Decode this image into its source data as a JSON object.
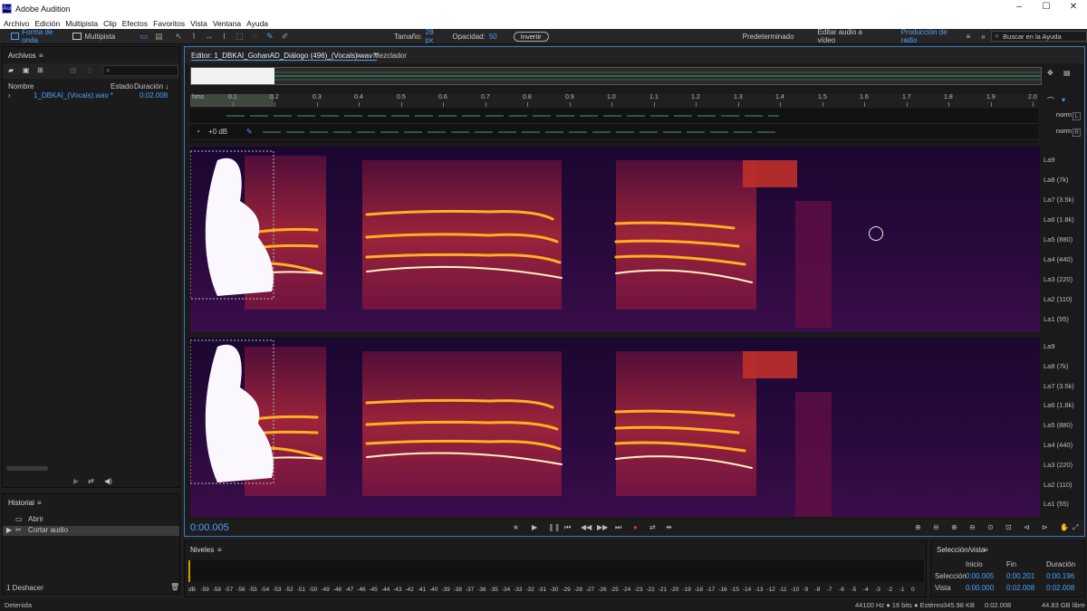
{
  "app": {
    "title": "Adobe Audition",
    "logo": "Au"
  },
  "window": {
    "minimize": "–",
    "maximize": "☐",
    "close": "✕"
  },
  "menu": [
    "Archivo",
    "Edición",
    "Multipista",
    "Clip",
    "Efectos",
    "Favoritos",
    "Vista",
    "Ventana",
    "Ayuda"
  ],
  "toolbar": {
    "waveform": "Forma de onda",
    "multitrack": "Multipista",
    "size_label": "Tamaño:",
    "size_value": "28 px",
    "opacity_label": "Opacidad:",
    "opacity_value": "50",
    "invert": "Invertir",
    "workspace_default": "Predeterminado",
    "workspace_video": "Editar audio a vídeo",
    "workspace_radio": "Producción de radio",
    "search_placeholder": "Buscar en la Ayuda"
  },
  "files": {
    "title": "Archivos",
    "col_name": "Nombre",
    "col_state": "Estado",
    "col_duration": "Duración ↓",
    "item_name": "1_DBKAI_(Vocals).wav *",
    "item_duration": "0:02.008"
  },
  "history": {
    "title": "Historial",
    "items": [
      "Abrir",
      "Cortar audio"
    ],
    "undo": "1 Deshacer"
  },
  "editor": {
    "tab": "Editor: 1_DBKAI_GohanAD_Diálogo (496)_(Vocals).wav *",
    "mixer": "Mezclador",
    "gain": "+0 dB",
    "norm": "norm",
    "channel_l": "L",
    "channel_r": "R",
    "timecode": "0:00.005"
  },
  "ruler": {
    "start": "hms",
    "labels": [
      "0.1",
      "0.2",
      "0.3",
      "0.4",
      "0.5",
      "0.6",
      "0.7",
      "0.8",
      "0.9",
      "1.0",
      "1.1",
      "1.2",
      "1.3",
      "1.4",
      "1.5",
      "1.6",
      "1.7",
      "1.8",
      "1.9",
      "2.0"
    ]
  },
  "hz_labels": [
    "La9",
    "La8 (7k)",
    "La7 (3.5k)",
    "La6 (1.8k)",
    "La5 (880)",
    "La4 (440)",
    "La3 (220)",
    "La2 (110)",
    "La1 (55)"
  ],
  "levels": {
    "title": "Niveles",
    "scale": [
      "dB",
      "-59",
      "-58",
      "-57",
      "-56",
      "-55",
      "-54",
      "-53",
      "-52",
      "-51",
      "-50",
      "-49",
      "-48",
      "-47",
      "-46",
      "-45",
      "-44",
      "-43",
      "-42",
      "-41",
      "-40",
      "-39",
      "-38",
      "-37",
      "-36",
      "-35",
      "-34",
      "-33",
      "-32",
      "-31",
      "-30",
      "-29",
      "-28",
      "-27",
      "-26",
      "-25",
      "-24",
      "-23",
      "-22",
      "-21",
      "-20",
      "-19",
      "-18",
      "-17",
      "-16",
      "-15",
      "-14",
      "-13",
      "-12",
      "-11",
      "-10",
      "-9",
      "-8",
      "-7",
      "-6",
      "-5",
      "-4",
      "-3",
      "-2",
      "-1",
      "0"
    ]
  },
  "selview": {
    "title": "Selección/vista",
    "h_start": "Inicio",
    "h_end": "Fin",
    "h_duration": "Duración",
    "sel_label": "Selección",
    "sel_start": "0:00.005",
    "sel_end": "0:00.201",
    "sel_duration": "0:00.196",
    "view_label": "Vista",
    "view_start": "0:00.000",
    "view_end": "0:02.008",
    "view_duration": "0:02.008"
  },
  "status": {
    "state": "Detenida",
    "format": "44100 Hz ● 16 bits ● Estéreo",
    "size": "345.98 KB",
    "duration": "0:02.008",
    "free": "44.83 GB libre"
  }
}
